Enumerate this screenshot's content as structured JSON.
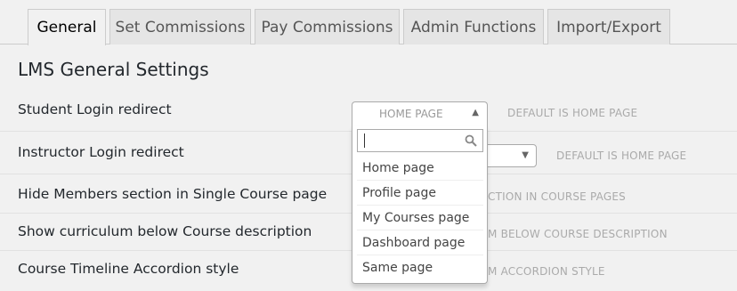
{
  "tabs": [
    {
      "label": "General",
      "active": true
    },
    {
      "label": "Set Commissions",
      "active": false
    },
    {
      "label": "Pay Commissions",
      "active": false
    },
    {
      "label": "Admin Functions",
      "active": false
    },
    {
      "label": "Import/Export",
      "active": false
    }
  ],
  "section_title": "LMS General Settings",
  "settings": [
    {
      "label": "Student Login redirect",
      "hint": "DEFAULT IS HOME PAGE"
    },
    {
      "label": "Instructor Login redirect",
      "hint": "DEFAULT IS HOME PAGE"
    },
    {
      "label": "Hide Members section in Single Course page",
      "hint": "CTION IN COURSE PAGES"
    },
    {
      "label": "Show curriculum below Course description",
      "hint": "M BELOW COURSE DESCRIPTION"
    },
    {
      "label": "Course Timeline Accordion style",
      "hint": "M ACCORDION STYLE"
    }
  ],
  "student_select": {
    "value": "HOME PAGE",
    "search_placeholder": "",
    "options": [
      "Home page",
      "Profile page",
      "My Courses page",
      "Dashboard page",
      "Same page"
    ]
  },
  "colors": {
    "background": "#f1f1f1",
    "tab_inactive": "#e5e5e5",
    "hint": "#aaaaaa"
  }
}
